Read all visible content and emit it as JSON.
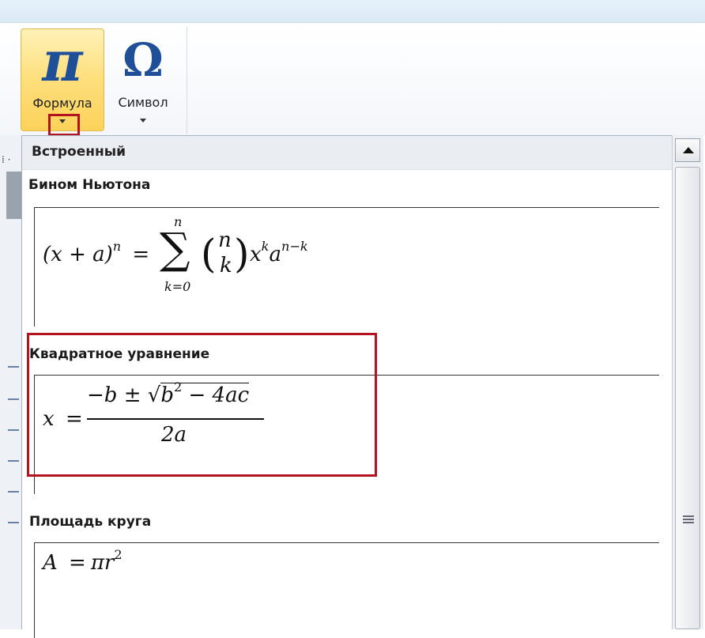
{
  "ribbon": {
    "formula_button": {
      "glyph": "π",
      "label": "Формула"
    },
    "symbol_button": {
      "glyph": "Ω",
      "label": "Символ"
    }
  },
  "gallery": {
    "category": "Встроенный",
    "items": [
      {
        "title": "Бином Ньютона",
        "lhs": "(x + a)",
        "lhs_exp": "n",
        "eq": "=",
        "sum_top": "n",
        "sum_symbol": "∑",
        "sum_bottom": "k=0",
        "binom_top": "n",
        "binom_bottom": "k",
        "term1": "x",
        "term1_exp": "k",
        "term2": "a",
        "term2_exp": "n−k"
      },
      {
        "title": "Квадратное уравнение",
        "lhs": "x",
        "eq": "=",
        "numerator_pre": "−b ± ",
        "sqrt": "√",
        "radicand": "b",
        "radicand_exp": "2",
        "radicand_rest": " − 4ac",
        "denominator": "2a"
      },
      {
        "title": "Площадь круга",
        "lhs": "A",
        "eq": "=",
        "rhs": "πr",
        "rhs_exp": "2"
      }
    ]
  },
  "colors": {
    "highlight": "#b3121e",
    "formula_button_bg": "#fddf7d",
    "icon_blue": "#1f4f99"
  }
}
